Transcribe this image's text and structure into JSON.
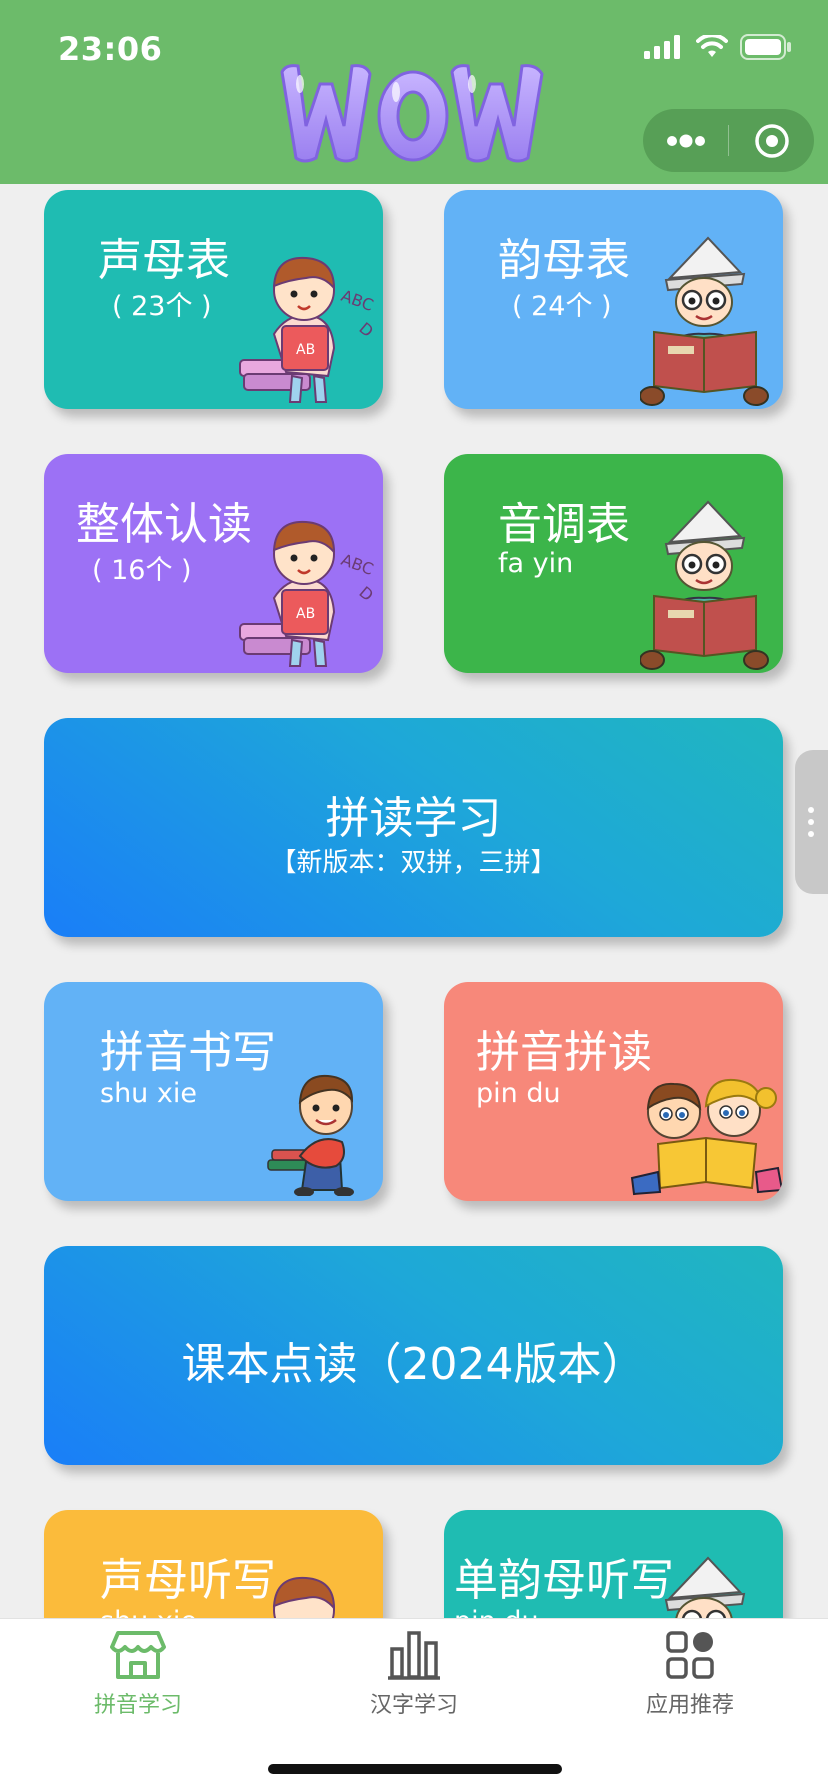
{
  "status_bar": {
    "time": "23:06"
  },
  "header": {
    "logo_text": "WOW"
  },
  "cards": {
    "initials": {
      "title": "声母表",
      "sub": "( 23个 )"
    },
    "finals": {
      "title": "韵母表",
      "sub": "( 24个 )"
    },
    "whole": {
      "title": "整体认读",
      "sub": "( 16个 )"
    },
    "tones": {
      "title": "音调表",
      "sub": "fa yin"
    },
    "spelling": {
      "title": "拼读学习",
      "sub": "【新版本：双拼，三拼】"
    },
    "writing": {
      "title": "拼音书写",
      "sub": "shu xie"
    },
    "reading": {
      "title": "拼音拼读",
      "sub": "pin du"
    },
    "textbook": {
      "title": "课本点读（2024版本）"
    },
    "dict_initials": {
      "title": "声母听写",
      "sub": "shu xie"
    },
    "dict_finals": {
      "title": "单韵母听写",
      "sub": "pin du"
    }
  },
  "tabbar": {
    "tabs": [
      {
        "label": "拼音学习",
        "icon": "shop-icon",
        "active": true
      },
      {
        "label": "汉字学习",
        "icon": "bar-chart-icon",
        "active": false
      },
      {
        "label": "应用推荐",
        "icon": "apps-grid-icon",
        "active": false
      }
    ]
  },
  "colors": {
    "header_green": "#6cbb6a",
    "teal": "#1fbcb2",
    "blue": "#62b2f6",
    "purple": "#9c71f5",
    "green": "#3cb54a",
    "salmon": "#f7887a",
    "yellow": "#fbbb3b",
    "gradient_start": "#1a7ef8",
    "gradient_end": "#20b6bf"
  }
}
